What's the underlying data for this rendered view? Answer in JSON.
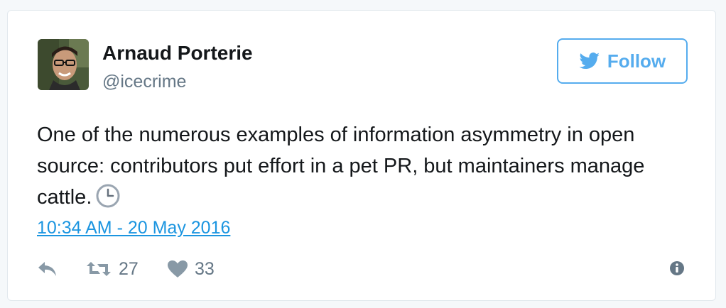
{
  "author": {
    "name": "Arnaud Porterie",
    "handle": "@icecrime"
  },
  "follow_button": {
    "label": "Follow"
  },
  "tweet": {
    "text": "One of the numerous examples of information asymmetry in open source: contributors put effort in a pet PR, but maintainers manage cattle.",
    "timestamp": "10:34 AM - 20 May 2016"
  },
  "actions": {
    "retweets": "27",
    "likes": "33"
  },
  "icons": {
    "follow": "twitter-bird-icon",
    "emoji": "clock-emoji-icon",
    "reply": "reply-icon",
    "retweet": "retweet-icon",
    "like": "heart-icon",
    "info": "info-icon"
  },
  "colors": {
    "accent": "#55acee",
    "link": "#1b95e0",
    "text": "#14171a",
    "muted": "#657786"
  }
}
